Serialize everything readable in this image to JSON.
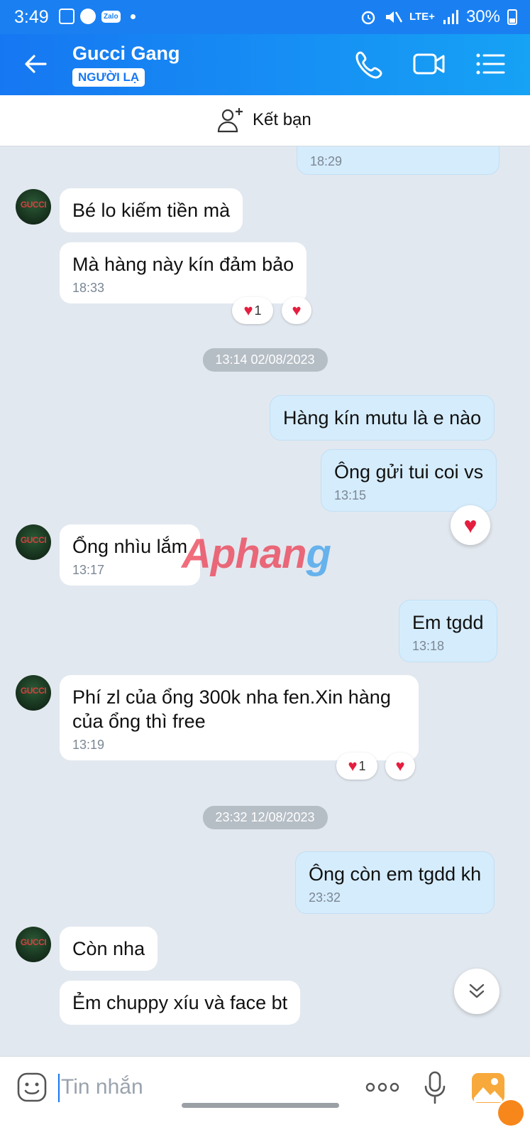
{
  "status": {
    "time": "3:49",
    "network": "LTE+",
    "battery": "30%",
    "app_icon_label": "Zalo"
  },
  "header": {
    "contact_name": "Gucci Gang",
    "badge": "NGƯỜI LẠ",
    "accent": "#1677f2"
  },
  "add_friend": {
    "label": "Kết bạn"
  },
  "avatar_text": "GUCCI",
  "messages": {
    "m0": {
      "time": "18:29"
    },
    "m1": {
      "text": "Bé lo kiếm tiền mà"
    },
    "m2": {
      "text": "Mà hàng này kín đảm bảo",
      "time": "18:33"
    },
    "m2_react_count": "1",
    "date1": "13:14 02/08/2023",
    "m3": {
      "text": "Hàng kín mutu là e nào"
    },
    "m4": {
      "text": "Ông gửi tui coi vs",
      "time": "13:15"
    },
    "m5": {
      "text": "Ổng nhìu lắm",
      "time": "13:17"
    },
    "m6": {
      "text": "Em tgdd",
      "time": "13:18"
    },
    "m7": {
      "text": "Phí zl của ổng 300k nha fen.Xin hàng của ổng thì free",
      "time": "13:19"
    },
    "m7_react_count": "1",
    "date2": "23:32 12/08/2023",
    "m8": {
      "text": "Ông còn em tgdd kh",
      "time": "23:32"
    },
    "m9": {
      "text": "Còn nha"
    },
    "m10": {
      "text": "Ẻm chuppy xíu và face bt"
    }
  },
  "watermark": {
    "part1": "Aphan",
    "part2": "g"
  },
  "composer": {
    "placeholder": "Tin nhắn"
  },
  "icons": [
    "back-arrow-icon",
    "phone-icon",
    "video-call-icon",
    "menu-list-icon",
    "add-friend-icon",
    "heart-icon",
    "chevron-double-down-icon",
    "emoji-icon",
    "more-dots-icon",
    "microphone-icon",
    "gallery-icon"
  ]
}
